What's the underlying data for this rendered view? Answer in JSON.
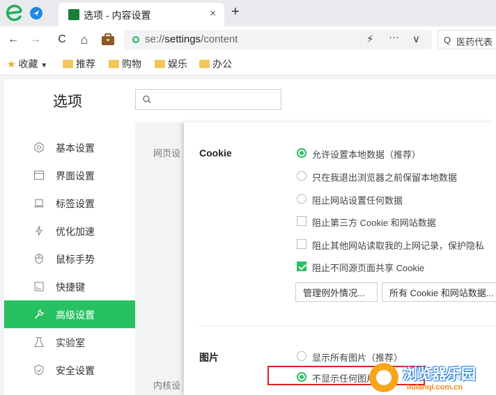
{
  "browser": {
    "tab": {
      "title": "选项 - 内容设置",
      "close": "×"
    },
    "new_tab": "+",
    "nav": {
      "back": "←",
      "forward": "→",
      "refresh": "C",
      "home": "⌂"
    },
    "address": {
      "scheme": "se://",
      "host": "settings",
      "path": "/content"
    },
    "addr_icons": {
      "lightning": "⚡",
      "more": "···",
      "dropdown": "∨"
    },
    "search": {
      "icon": "Q",
      "text": "医药代表"
    }
  },
  "bookmarks": [
    {
      "label": "收藏",
      "icon": "star-icon"
    },
    {
      "label": "推荐",
      "icon": "folder-icon"
    },
    {
      "label": "购物",
      "icon": "folder-icon"
    },
    {
      "label": "娱乐",
      "icon": "folder-icon"
    },
    {
      "label": "办公",
      "icon": "folder-icon"
    }
  ],
  "settings": {
    "title": "选项",
    "search_placeholder": "",
    "sidebar": [
      {
        "label": "基本设置",
        "icon": "basic-settings-icon",
        "active": false
      },
      {
        "label": "界面设置",
        "icon": "interface-icon",
        "active": false
      },
      {
        "label": "标签设置",
        "icon": "tab-settings-icon",
        "active": false
      },
      {
        "label": "优化加速",
        "icon": "lightning-icon",
        "active": false
      },
      {
        "label": "鼠标手势",
        "icon": "mouse-icon",
        "active": false
      },
      {
        "label": "快捷键",
        "icon": "keyboard-icon",
        "active": false
      },
      {
        "label": "高级设置",
        "icon": "wrench-icon",
        "active": true
      },
      {
        "label": "实验室",
        "icon": "flask-icon",
        "active": false
      },
      {
        "label": "安全设置",
        "icon": "shield-icon",
        "active": false
      }
    ],
    "mid_labels": [
      "网页设",
      "内核设"
    ],
    "cookie": {
      "label": "Cookie",
      "options": [
        {
          "type": "radio",
          "text": "允许设置本地数据（推荐）",
          "checked": true
        },
        {
          "type": "radio",
          "text": "只在我退出浏览器之前保留本地数据",
          "checked": false
        },
        {
          "type": "radio",
          "text": "阻止网站设置任何数据",
          "checked": false
        },
        {
          "type": "checkbox",
          "text": "阻止第三方 Cookie 和网站数据",
          "checked": false
        },
        {
          "type": "checkbox",
          "text": "阻止其他网站读取我的上网记录，保护隐私",
          "checked": false
        },
        {
          "type": "checkbox",
          "text": "阻止不同源页面共享 Cookie",
          "checked": true
        }
      ],
      "buttons": [
        "管理例外情况...",
        "所有 Cookie 和网站数据..."
      ]
    },
    "images": {
      "label": "图片",
      "options": [
        {
          "type": "radio",
          "text": "显示所有图片（推荐）",
          "checked": false
        },
        {
          "type": "radio",
          "text": "不显示任何图片",
          "checked": true
        }
      ]
    }
  },
  "watermark": {
    "title": "浏览器乐园",
    "url": "liulanqi.com.cn"
  },
  "colors": {
    "accent": "#27c161",
    "highlight": "#e0201c",
    "sidebar_bg": "#ffffff",
    "page_bg": "#f2f3f5"
  }
}
